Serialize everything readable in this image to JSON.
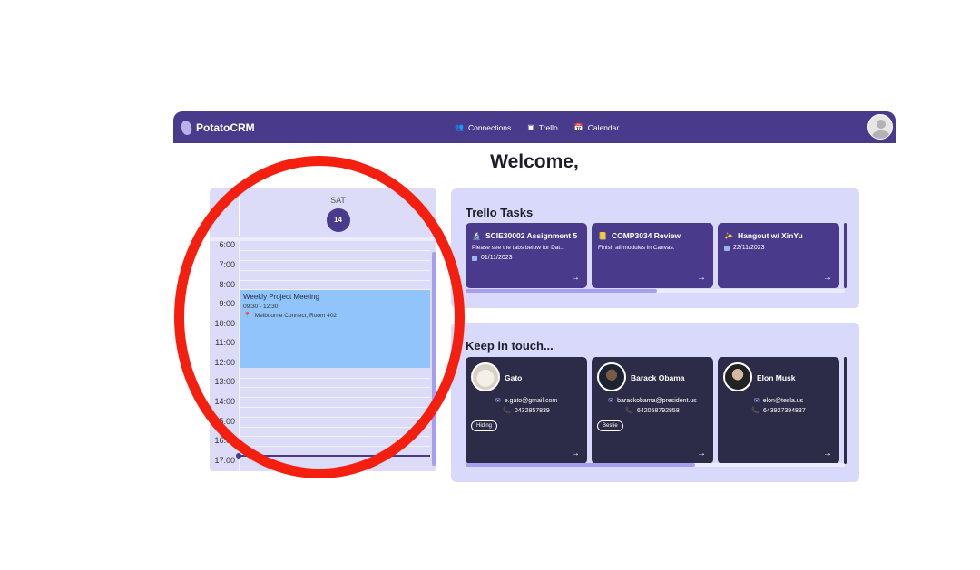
{
  "navbar": {
    "brand": "PotatoCRM",
    "links": [
      {
        "label": "Connections",
        "icon": "users-icon",
        "glyph": "👥"
      },
      {
        "label": "Trello",
        "icon": "board-icon",
        "glyph": "▣"
      },
      {
        "label": "Calendar",
        "icon": "calendar-icon",
        "glyph": "📅"
      }
    ]
  },
  "welcome": "Welcome,",
  "calendar": {
    "day": "SAT",
    "date": "14",
    "times": [
      "6:00",
      "7:00",
      "8:00",
      "9:00",
      "10:00",
      "11:00",
      "12:00",
      "13:00",
      "14:00",
      "15:00",
      "16:00",
      "17:00"
    ],
    "event": {
      "title": "Weekly Project Meeting",
      "time": "09:30 - 12:30",
      "location": "Melbourne Connect, Room 402"
    }
  },
  "trello": {
    "title": "Trello Tasks",
    "cards": [
      {
        "emoji": "🔬",
        "title": "SCIE30002 Assignment 5",
        "desc": "Please see the tabs below for Dat...",
        "date": "01/11/2023"
      },
      {
        "emoji": "📒",
        "title": "COMP3034 Review",
        "desc": "Finish all modules in Canvas.",
        "date": ""
      },
      {
        "emoji": "✨",
        "title": "Hangout w/ XinYu",
        "desc": "",
        "date": "22/11/2023"
      }
    ]
  },
  "contacts": {
    "title": "Keep in touch...",
    "cards": [
      {
        "name": "Gato",
        "email": "e.gato@gmail.com",
        "phone": "0432857839",
        "tag": "Hiding"
      },
      {
        "name": "Barack Obama",
        "email": "barackobama@president.us",
        "phone": "642058792858",
        "tag": "Bestie"
      },
      {
        "name": "Elon Musk",
        "email": "elon@tesla.us",
        "phone": "643927394837",
        "tag": ""
      }
    ]
  },
  "colors": {
    "nav": "#4a3a8c",
    "panel": "#d9d9fb",
    "annotation": "#f51f0f",
    "event": "#90c4fa"
  }
}
